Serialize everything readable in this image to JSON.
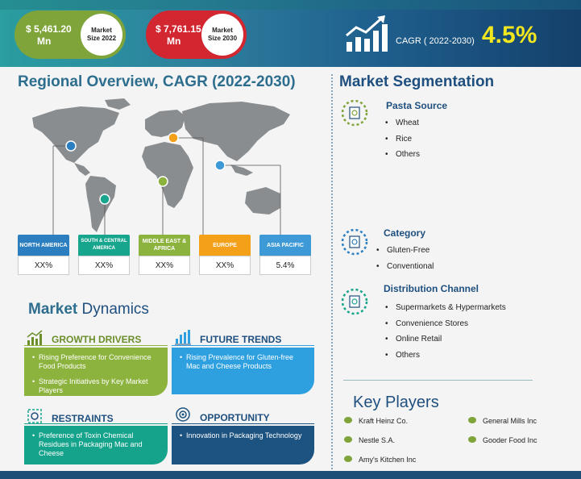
{
  "header": {
    "market_2022": {
      "value": "$ 5,461.20",
      "unit": "Mn",
      "label": "Market Size 2022"
    },
    "market_2030": {
      "value": "$ 7,761.15",
      "unit": "Mn",
      "label": "Market Size 2030"
    },
    "cagr_label": "CAGR ( 2022-2030)",
    "cagr_value": "4.5%"
  },
  "regional": {
    "title": "Regional Overview,  CAGR (2022-2030)",
    "regions": [
      {
        "name": "NORTH AMERICA",
        "value": "XX%"
      },
      {
        "name": "SOUTH & CENTRAL AMERICA",
        "value": "XX%"
      },
      {
        "name": "MIDDLE EAST & AFRICA",
        "value": "XX%"
      },
      {
        "name": "EUROPE",
        "value": "XX%"
      },
      {
        "name": "ASIA PACIFIC",
        "value": "5.4%"
      }
    ]
  },
  "dynamics": {
    "title_bold": "Market",
    "title_rest": " Dynamics",
    "growth_drivers": {
      "title": "GROWTH DRIVERS",
      "items": [
        "Rising Preference for Convenience Food Products",
        "Strategic Initiatives by Key Market Players"
      ]
    },
    "future_trends": {
      "title": "FUTURE TRENDS",
      "items": [
        "Rising Prevalence for Gluten-free Mac and Cheese Products"
      ]
    },
    "restraints": {
      "title": "RESTRAINTS",
      "items": [
        "Preference of Toxin Chemical Residues in Packaging Mac and Cheese"
      ]
    },
    "opportunity": {
      "title": "OPPORTUNITY",
      "items": [
        "Innovation in Packaging Technology"
      ]
    }
  },
  "segmentation": {
    "title": "Market Segmentation",
    "pasta_source": {
      "title": "Pasta Source",
      "items": [
        "Wheat",
        "Rice",
        "Others"
      ]
    },
    "category": {
      "title": "Category",
      "items": [
        "Gluten-Free",
        "Conventional"
      ]
    },
    "distribution": {
      "title": "Distribution Channel",
      "items": [
        "Supermarkets & Hypermarkets",
        "Convenience Stores",
        "Online Retail",
        "Others"
      ]
    }
  },
  "key_players": {
    "title": "Key Players",
    "players": [
      "Kraft Heinz Co.",
      "General Mills Inc",
      "Nestle S.A.",
      "Gooder Food Inc",
      "Amy's Kitchen Inc"
    ]
  }
}
